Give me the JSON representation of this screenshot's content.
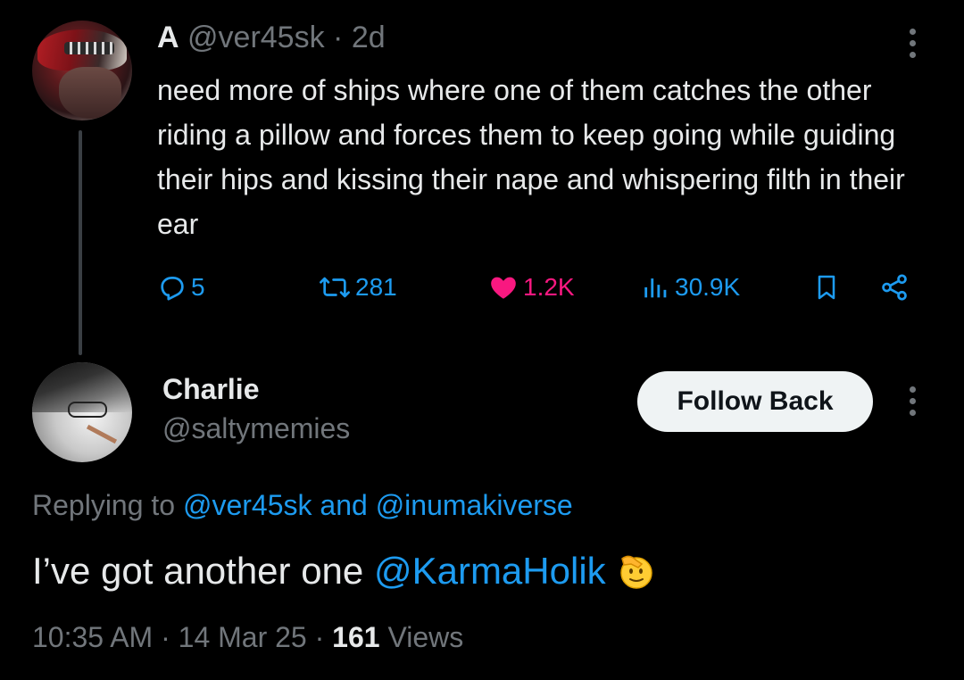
{
  "parent_tweet": {
    "display_name": "A",
    "handle": "@ver45sk",
    "separator": "·",
    "age": "2d",
    "text": "need more of ships where one of them catches the other riding a pillow and forces them to keep going while guiding their hips and kissing their nape and whispering filth in their ear",
    "actions": {
      "replies": "5",
      "retweets": "281",
      "likes": "1.2K",
      "views": "30.9K"
    },
    "icons": {
      "reply": "reply-icon",
      "retweet": "retweet-icon",
      "like": "heart-icon",
      "views": "views-icon",
      "bookmark": "bookmark-icon",
      "share": "share-icon",
      "more": "more-icon"
    }
  },
  "reply_tweet": {
    "display_name": "Charlie",
    "handle": "@saltymemies",
    "follow_button": "Follow Back",
    "replying_prefix": "Replying to",
    "replying_user_1": "@ver45sk",
    "replying_and": "and",
    "replying_user_2": "@inumakiverse",
    "text_plain": "I’ve got another one",
    "text_mention": "@KarmaHolik",
    "emoji": "saluting-face-emoji",
    "time": "10:35 AM",
    "date": "14 Mar 25",
    "separator": "·",
    "views_count": "161",
    "views_label": "Views"
  },
  "colors": {
    "background": "#000000",
    "text": "#e7e9ea",
    "muted": "#71767b",
    "link": "#1d9bf0",
    "like": "#f91880",
    "button_bg": "#eff3f4"
  }
}
